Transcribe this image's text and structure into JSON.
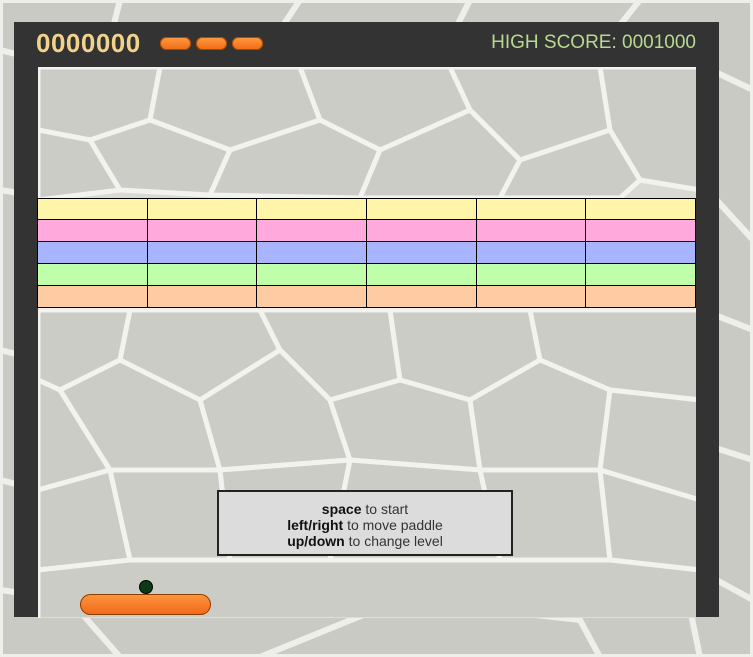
{
  "hud": {
    "score": "0000000",
    "lives_remaining": 3,
    "high_score_label": "HIGH SCORE: 0001000"
  },
  "bricks": {
    "rows": [
      {
        "color": "#fff5a9",
        "count": 6
      },
      {
        "color": "#ffa9dd",
        "count": 6
      },
      {
        "color": "#a9b4ff",
        "count": 6
      },
      {
        "color": "#c0ffa9",
        "count": 6
      },
      {
        "color": "#ffcba2",
        "count": 6
      }
    ]
  },
  "instructions": {
    "line1_key": "space",
    "line1_text": " to start",
    "line2_key": "left/right",
    "line2_text": " to move paddle",
    "line3_key": "up/down",
    "line3_text": " to change level"
  },
  "colors": {
    "frame": "#333333",
    "score": "#f2d38b",
    "high_score": "#b7d992",
    "paddle": "#f37a22",
    "ball": "#0c3a17"
  }
}
